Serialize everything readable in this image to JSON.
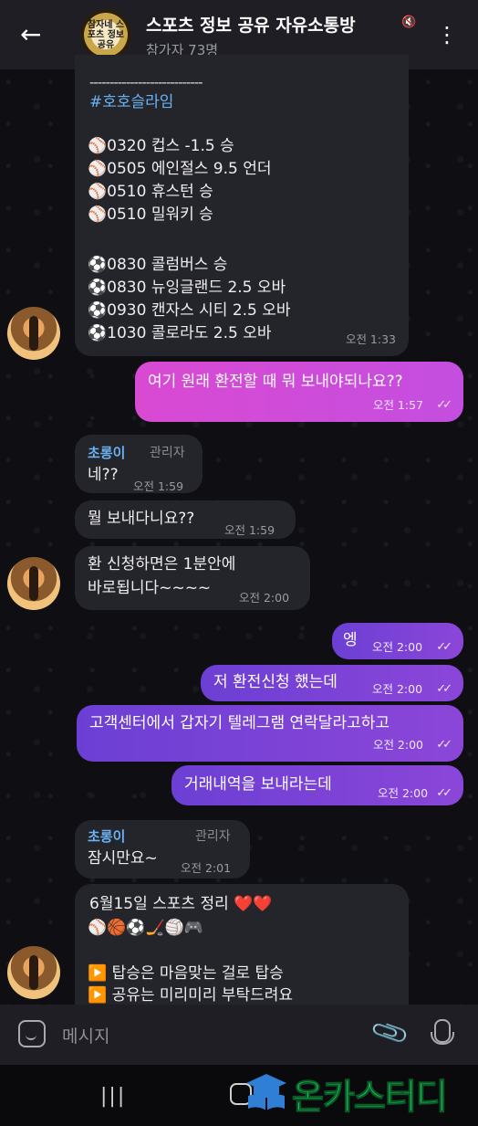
{
  "header": {
    "back_icon": "arrow-left-icon",
    "group_avatar_text": "참자네 스포츠 정보공유",
    "title": "스포츠 정보 공유 자유소통방",
    "mute_icon": "muted-icon",
    "subtitle": "참가자 73명",
    "menu_icon": "more-vertical-icon"
  },
  "messages": {
    "m1": {
      "divider": "----------------------------",
      "hashtag": "#호호슬라임",
      "lines_baseball": [
        "⚾0320 컵스 -1.5 승",
        "⚾0505 에인절스 9.5 언더",
        "⚾0510 휴스턴 승",
        "⚾0510 밀워키 승"
      ],
      "lines_soccer": [
        "⚽0830 콜럼버스 승",
        "⚽0830 뉴잉글랜드 2.5 오바",
        "⚽0930 캔자스 시티 2.5 오바",
        "⚽1030 콜로라도 2.5 오바"
      ],
      "time": "오전 1:33"
    },
    "m2": {
      "text": "여기 원래 환전할 때 뭐 보내야되나요??",
      "time": "오전 1:57"
    },
    "m3": {
      "sender": "초롱이",
      "role": "관리자",
      "text": "네??",
      "time": "오전 1:59"
    },
    "m4": {
      "text": "뭘 보내다니요??",
      "time": "오전 1:59"
    },
    "m5": {
      "line1": "환 신청하면은 1분안에",
      "line2": "바로됩니다~~~~",
      "time": "오전 2:00"
    },
    "m6": {
      "text": "엥",
      "time": "오전 2:00"
    },
    "m7": {
      "text": "저 환전신청 했는데",
      "time": "오전 2:00"
    },
    "m8": {
      "text": "고객센터에서 갑자기 텔레그램 연락달라고하고",
      "time": "오전 2:00"
    },
    "m9": {
      "text": "거래내역을 보내라는데",
      "time": "오전 2:00"
    },
    "m10": {
      "sender": "초롱이",
      "role": "관리자",
      "text": "잠시만요~",
      "time": "오전 2:01"
    },
    "m11": {
      "line1": "6월15일 스포츠 정리 ❤️❤️",
      "emoji_row": "⚾🏀⚽🏒🏐🎮",
      "line3": "▶️ 탑승은 마음맞는 걸로 탑승",
      "line4": "▶️ 공유는 미리미리 부탁드려요"
    },
    "read_check": "✓✓"
  },
  "input": {
    "placeholder": "메시지",
    "sticker_icon": "sticker-icon",
    "attach_icon": "paperclip-icon",
    "mic_icon": "microphone-icon"
  },
  "navbar": {
    "recent_icon": "recent-apps-icon",
    "home_icon": "home-icon"
  },
  "watermark": {
    "text": "온카스터디"
  },
  "colors": {
    "accent_pink": "#d94ad2",
    "accent_purple": "#6c3fd4",
    "sender_blue": "#6ab2f2",
    "header_bg": "#1e1e24"
  }
}
